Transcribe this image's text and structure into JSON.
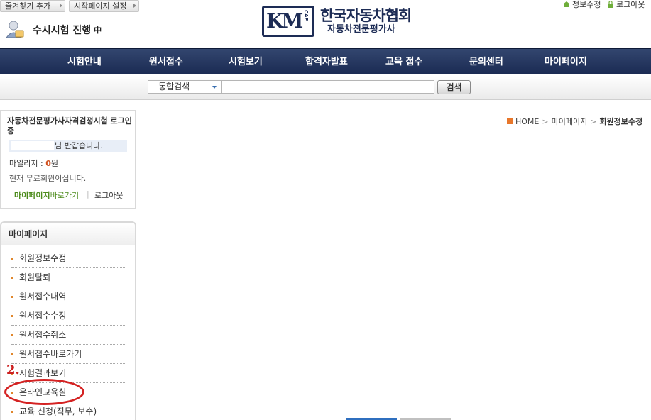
{
  "top": {
    "favorite_label": "즐겨찾기 추가",
    "start_page_label": "시작페이지 설정",
    "info_edit_label": "정보수정",
    "logout_label": "로그아웃"
  },
  "status": {
    "text": "수시시험 진행",
    "suffix": "中"
  },
  "logo": {
    "mark": "KM",
    "mark_sub": "CAE",
    "title": "한국자동차협회",
    "subtitle": "자동차전문평가사"
  },
  "nav": {
    "items": [
      {
        "label": "시험안내"
      },
      {
        "label": "원서접수"
      },
      {
        "label": "시험보기"
      },
      {
        "label": "합격자발표"
      },
      {
        "label": "교육 접수"
      },
      {
        "label": "문의센터"
      },
      {
        "label": "마이페이지"
      }
    ]
  },
  "search": {
    "select_value": "통합검색",
    "input_value": "",
    "button_label": "검색"
  },
  "login": {
    "title": "자동차전문평가사자격검정시험 로그인중",
    "welcome": "님 반갑습니다.",
    "mileage_label": "마일리지 : ",
    "mileage_value": "0",
    "mileage_unit": "원",
    "member_type": "현재 무료회원이십니다.",
    "mypage_strong": "마이페이지",
    "mypage_rest": "바로가기",
    "separator": "|",
    "logout": "로그아웃"
  },
  "menu": {
    "title": "마이페이지",
    "items": [
      {
        "label": "회원정보수정"
      },
      {
        "label": "회원탈퇴"
      },
      {
        "label": "원서접수내역"
      },
      {
        "label": "원서접수수정"
      },
      {
        "label": "원서접수취소"
      },
      {
        "label": "원서접수바로가기"
      },
      {
        "label": "시험결과보기"
      },
      {
        "label": "온라인교육실"
      },
      {
        "label": "교육 신청(직무, 보수)"
      }
    ]
  },
  "annotation": {
    "number": "2."
  },
  "breadcrumb": {
    "home": "HOME",
    "sep": ">",
    "level1": "마이페이지",
    "current": "회원정보수정"
  },
  "colors": {
    "nav_bg": "#1a2a52",
    "brand": "#1d2c55",
    "annotation": "#d42222",
    "accent_orange": "#e8772b",
    "link_green": "#4b8a1a"
  }
}
